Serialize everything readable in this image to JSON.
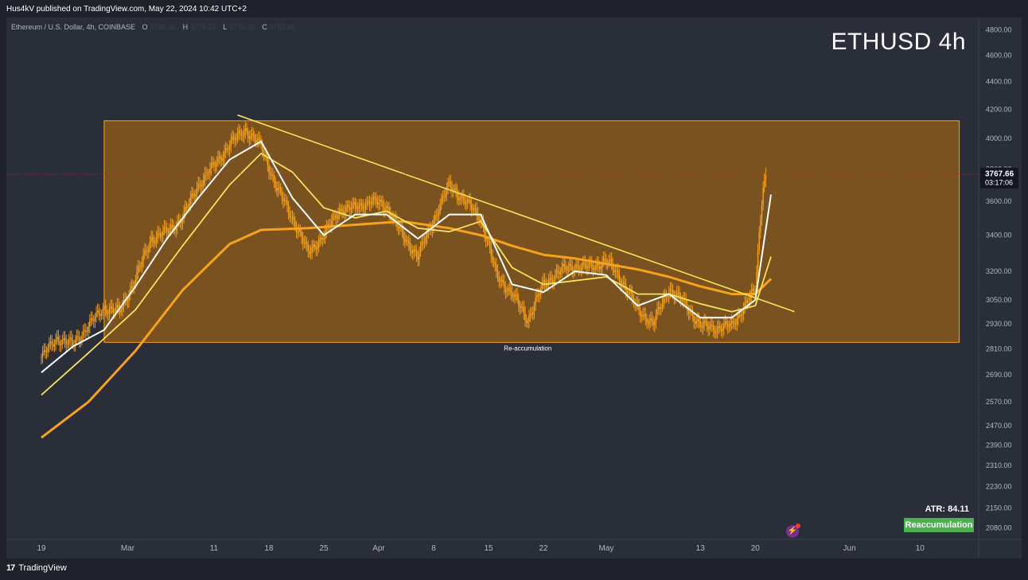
{
  "publisher_line": "Hus4kV published on TradingView.com, May 22, 2024 10:42 UTC+2",
  "symbol": {
    "description": "Ethereum / U.S. Dollar, 4h, COINBASE",
    "o_label": "O",
    "o_value": "3746.66",
    "h_label": "H",
    "h_value": "3779.24",
    "l_label": "L",
    "l_value": "3734.16",
    "c_label": "C",
    "c_value": "3767.66"
  },
  "watermark_title": "ETHUSD 4h",
  "last_price": {
    "value": "3767.66",
    "countdown": "03:17:06"
  },
  "atr_text": "ATR: 84.11",
  "badge_text": "Reaccumulation",
  "brand": {
    "logo_text": "TradingView"
  },
  "colors": {
    "background": "#1f222b",
    "range_box_fill": "#8c5a1a",
    "range_box_border": "#f7a21b",
    "candles": "#f7a21b",
    "ma_fast": "#ffffff",
    "ma_mid": "#f5e15a",
    "ma_slow": "#f7a21b",
    "trendline": "#f5e15a",
    "badge": "#4caf50",
    "price_line": "#b22833"
  },
  "chart_data": {
    "type": "line",
    "title": "ETHUSD 4h",
    "y_axis": {
      "ticks": [
        2080,
        2150,
        2230,
        2310,
        2390,
        2470,
        2570,
        2690,
        2810,
        2930,
        3050,
        3200,
        3400,
        3600,
        3800,
        4000,
        4200,
        4400,
        4600,
        4800
      ],
      "tick_labels": [
        "2080.00",
        "2150.00",
        "2230.00",
        "2310.00",
        "2390.00",
        "2470.00",
        "2570.00",
        "2690.00",
        "2810.00",
        "2930.00",
        "3050.00",
        "3200.00",
        "3400.00",
        "3600.00",
        "3800.00",
        "4000.00",
        "4200.00",
        "4400.00",
        "4600.00",
        "4800.00"
      ],
      "scale": "log",
      "range": [
        2040,
        4900
      ]
    },
    "x_axis": {
      "labels": [
        "19",
        "Mar",
        "11",
        "18",
        "25",
        "Apr",
        "8",
        "15",
        "22",
        "May",
        "13",
        "20",
        "Jun",
        "10"
      ],
      "label_days": [
        0,
        11,
        22,
        29,
        36,
        43,
        50,
        57,
        64,
        72,
        84,
        91,
        103,
        112
      ],
      "day0": "Feb 19",
      "last_day": 92.4
    },
    "range_box": {
      "x_start_day": 8.0,
      "x_end_day": 117.0,
      "y_low": 2840,
      "y_high": 4120,
      "label": "Re-accumulation"
    },
    "trendline": {
      "points": [
        [
          25.0,
          4160
        ],
        [
          96.0,
          2990
        ]
      ]
    },
    "series": [
      {
        "key": "price",
        "points": [
          [
            0,
            2770
          ],
          [
            2,
            2860
          ],
          [
            4,
            2830
          ],
          [
            6,
            2920
          ],
          [
            8,
            3010
          ],
          [
            10,
            2990
          ],
          [
            12,
            3160
          ],
          [
            14,
            3380
          ],
          [
            16,
            3420
          ],
          [
            18,
            3500
          ],
          [
            20,
            3700
          ],
          [
            22,
            3820
          ],
          [
            24,
            3960
          ],
          [
            26,
            4060
          ],
          [
            28,
            3950
          ],
          [
            30,
            3680
          ],
          [
            32,
            3500
          ],
          [
            34,
            3300
          ],
          [
            36,
            3400
          ],
          [
            38,
            3550
          ],
          [
            40,
            3560
          ],
          [
            42,
            3600
          ],
          [
            44,
            3570
          ],
          [
            46,
            3400
          ],
          [
            48,
            3280
          ],
          [
            50,
            3490
          ],
          [
            52,
            3700
          ],
          [
            54,
            3600
          ],
          [
            56,
            3500
          ],
          [
            58,
            3180
          ],
          [
            60,
            3080
          ],
          [
            62,
            2950
          ],
          [
            64,
            3130
          ],
          [
            66,
            3200
          ],
          [
            68,
            3230
          ],
          [
            70,
            3220
          ],
          [
            72,
            3260
          ],
          [
            74,
            3150
          ],
          [
            76,
            3000
          ],
          [
            78,
            2930
          ],
          [
            80,
            3110
          ],
          [
            82,
            3030
          ],
          [
            84,
            2920
          ],
          [
            86,
            2910
          ],
          [
            88,
            2920
          ],
          [
            90,
            3040
          ],
          [
            91,
            3100
          ],
          [
            92,
            3710
          ],
          [
            92.4,
            3768
          ]
        ]
      },
      {
        "key": "ma_fast",
        "points": [
          [
            0,
            2700
          ],
          [
            4,
            2820
          ],
          [
            8,
            2900
          ],
          [
            12,
            3120
          ],
          [
            16,
            3380
          ],
          [
            20,
            3620
          ],
          [
            24,
            3860
          ],
          [
            28,
            3980
          ],
          [
            32,
            3620
          ],
          [
            36,
            3400
          ],
          [
            40,
            3520
          ],
          [
            44,
            3520
          ],
          [
            48,
            3380
          ],
          [
            52,
            3520
          ],
          [
            56,
            3520
          ],
          [
            60,
            3130
          ],
          [
            64,
            3090
          ],
          [
            68,
            3200
          ],
          [
            72,
            3180
          ],
          [
            76,
            3020
          ],
          [
            80,
            3080
          ],
          [
            84,
            2960
          ],
          [
            88,
            2960
          ],
          [
            91,
            3050
          ],
          [
            93,
            3640
          ]
        ]
      },
      {
        "key": "ma_mid",
        "points": [
          [
            0,
            2600
          ],
          [
            6,
            2790
          ],
          [
            12,
            3000
          ],
          [
            18,
            3340
          ],
          [
            24,
            3700
          ],
          [
            28,
            3900
          ],
          [
            32,
            3780
          ],
          [
            36,
            3560
          ],
          [
            40,
            3500
          ],
          [
            44,
            3540
          ],
          [
            48,
            3440
          ],
          [
            52,
            3420
          ],
          [
            56,
            3480
          ],
          [
            60,
            3220
          ],
          [
            64,
            3130
          ],
          [
            68,
            3150
          ],
          [
            72,
            3170
          ],
          [
            76,
            3080
          ],
          [
            80,
            3080
          ],
          [
            84,
            3030
          ],
          [
            88,
            2990
          ],
          [
            91,
            3020
          ],
          [
            93,
            3280
          ]
        ]
      },
      {
        "key": "ma_slow",
        "points": [
          [
            0,
            2420
          ],
          [
            6,
            2570
          ],
          [
            12,
            2800
          ],
          [
            18,
            3100
          ],
          [
            24,
            3350
          ],
          [
            28,
            3430
          ],
          [
            34,
            3440
          ],
          [
            40,
            3460
          ],
          [
            46,
            3480
          ],
          [
            52,
            3440
          ],
          [
            56,
            3400
          ],
          [
            60,
            3340
          ],
          [
            64,
            3290
          ],
          [
            68,
            3270
          ],
          [
            72,
            3240
          ],
          [
            76,
            3210
          ],
          [
            80,
            3170
          ],
          [
            84,
            3120
          ],
          [
            88,
            3080
          ],
          [
            91,
            3080
          ],
          [
            93,
            3160
          ]
        ]
      }
    ]
  }
}
